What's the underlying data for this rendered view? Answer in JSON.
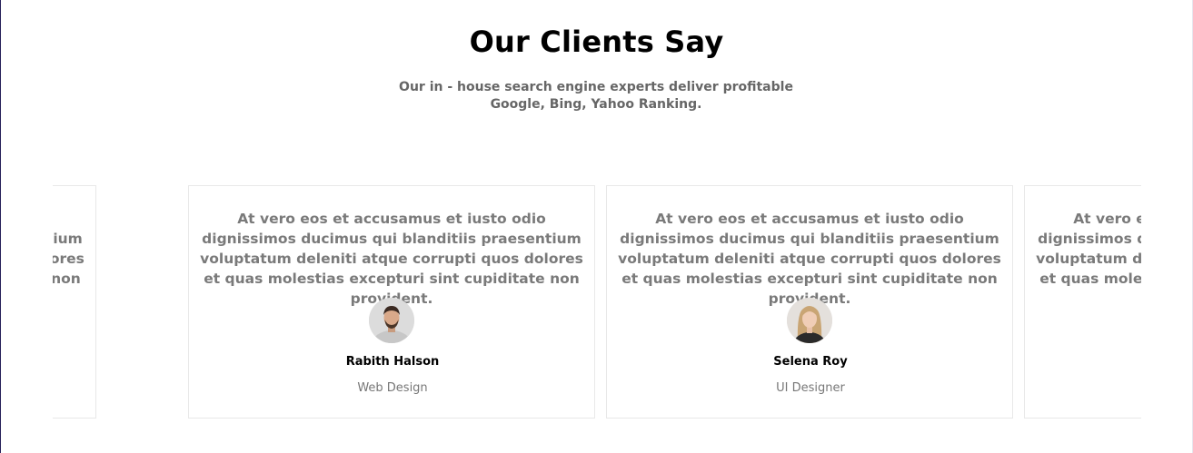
{
  "section": {
    "title": "Our Clients Say",
    "subtitle": "Our in - house search engine experts deliver profitable Google, Bing, Yahoo Ranking."
  },
  "testimonials": [
    {
      "quote": "At vero eos et accusamus et iusto odio dignissimos ducimus qui blanditiis praesentium voluptatum deleniti atque corrupti quos dolores et quas molestias excepturi sint cupiditate non provident.",
      "name": "",
      "role": "",
      "avatar_icon": "person-avatar-icon"
    },
    {
      "quote": "At vero eos et accusamus et iusto odio dignissimos ducimus qui blanditiis praesentium voluptatum deleniti atque corrupti quos dolores et quas molestias excepturi sint cupiditate non provident.",
      "name": "Rabith Halson",
      "role": "Web Design",
      "avatar_icon": "man-avatar-icon"
    },
    {
      "quote": "At vero eos et accusamus et iusto odio dignissimos ducimus qui blanditiis praesentium voluptatum deleniti atque corrupti quos dolores et quas molestias excepturi sint cupiditate non provident.",
      "name": "Selena Roy",
      "role": "UI Designer",
      "avatar_icon": "woman-avatar-icon"
    },
    {
      "quote": "At vero eos et accusamus et iusto odio dignissimos ducimus qui blanditiis praesentium voluptatum deleniti atque corrupti quos dolores et quas molestias excepturi sint cupiditate non provident.",
      "name": "",
      "role": "",
      "avatar_icon": "person-avatar-icon"
    }
  ],
  "colors": {
    "title": "#000000",
    "body_text": "#7a7a7a",
    "card_border": "#e8e8e8"
  }
}
